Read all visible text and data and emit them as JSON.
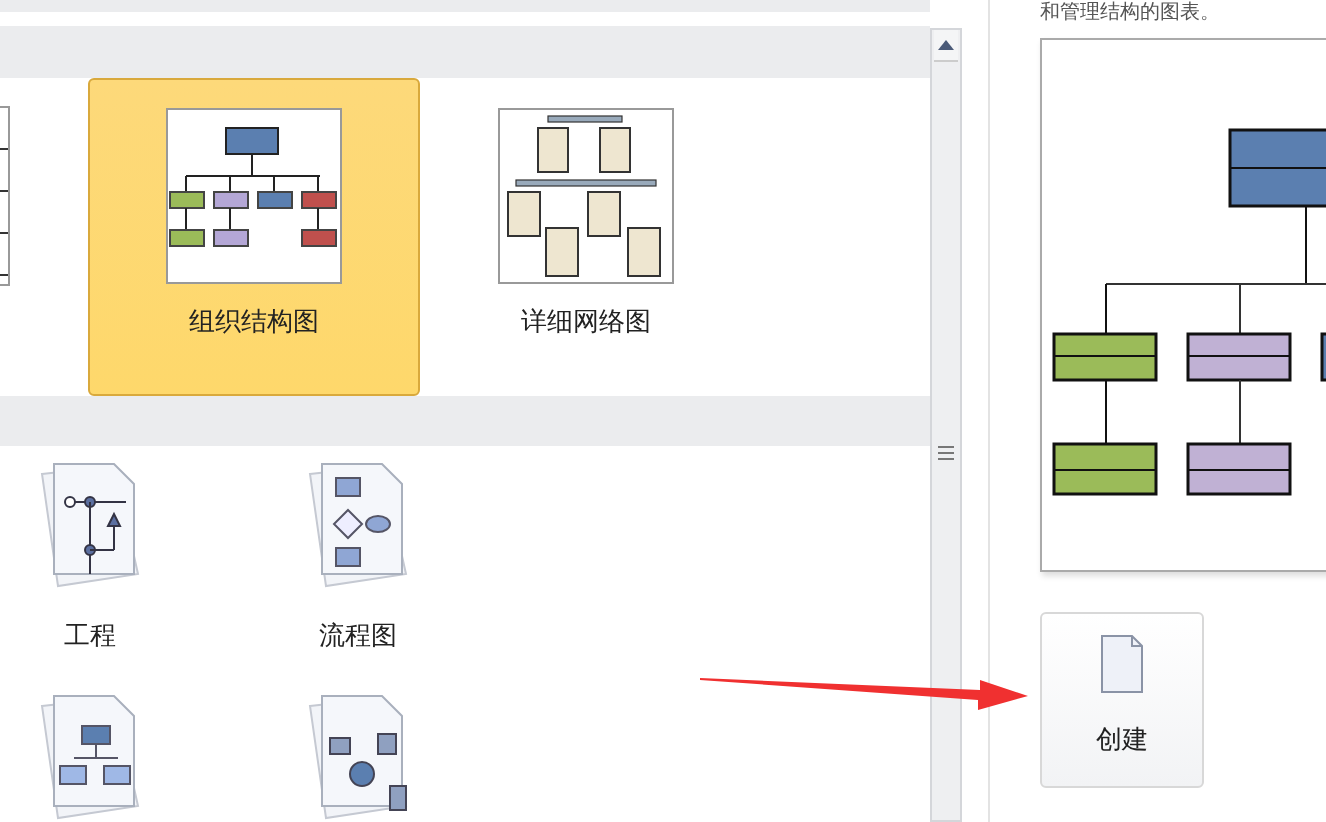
{
  "featured_templates": [
    {
      "label": "组织结构图",
      "kind": "org",
      "selected": true
    },
    {
      "label": "详细网络图",
      "kind": "network",
      "selected": false
    }
  ],
  "templates": [
    {
      "label": "工程",
      "kind": "engineering"
    },
    {
      "label": "流程图",
      "kind": "flowchart"
    },
    {
      "kind": "hierarchy"
    },
    {
      "kind": "network"
    }
  ],
  "preview": {
    "description": "和管理结构的图表。"
  },
  "create_button": {
    "label": "创建"
  }
}
